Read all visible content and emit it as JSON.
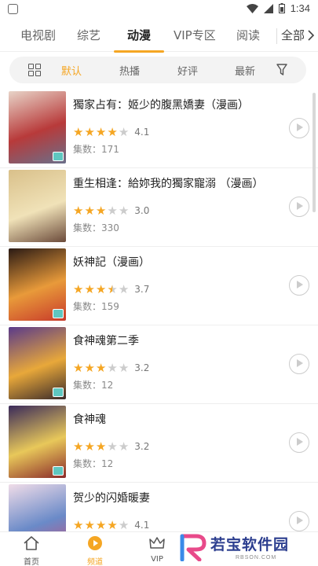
{
  "status_bar": {
    "time": "1:34"
  },
  "tabs": [
    {
      "label": "电视剧"
    },
    {
      "label": "综艺"
    },
    {
      "label": "动漫",
      "active": true
    },
    {
      "label": "VIP专区"
    },
    {
      "label": "阅读"
    }
  ],
  "tabs_more": "全部",
  "filters": [
    {
      "label": "默认",
      "active": true
    },
    {
      "label": "热播"
    },
    {
      "label": "好评"
    },
    {
      "label": "最新"
    }
  ],
  "items": [
    {
      "title": "獨家占有：姬少的腹黑嬌妻（漫画）",
      "rating": "4.1",
      "stars_filled": 4,
      "episodes": "集数：171",
      "cover_colors": [
        "#e8d4c8",
        "#b83a3a",
        "#6a6f8a"
      ]
    },
    {
      "title": "重生相逢：給妳我的獨家寵溺 （漫画）",
      "rating": "3.0",
      "stars_filled": 3,
      "episodes": "集数：330",
      "cover_colors": [
        "#d9c08a",
        "#f0e2b8",
        "#6b4a3a"
      ]
    },
    {
      "title": "妖神記（漫画）",
      "rating": "3.7",
      "stars_filled": 3.5,
      "episodes": "集数：159",
      "cover_colors": [
        "#2a1a14",
        "#e89a3a",
        "#c83a2a"
      ]
    },
    {
      "title": "食神魂第二季",
      "rating": "3.2",
      "stars_filled": 3,
      "episodes": "集数：12",
      "cover_colors": [
        "#5a3a8a",
        "#e8a83a",
        "#3a2a2a"
      ]
    },
    {
      "title": "食神魂",
      "rating": "3.2",
      "stars_filled": 3,
      "episodes": "集数：12",
      "cover_colors": [
        "#3a2a5a",
        "#e8c85a",
        "#8a2a2a"
      ]
    },
    {
      "title": "贺少的闪婚暖妻",
      "rating": "4.1",
      "stars_filled": 4,
      "episodes": "",
      "cover_colors": [
        "#f0dce8",
        "#6a8ac8",
        "#c84a7a"
      ]
    }
  ],
  "bottom_nav": [
    {
      "label": "首页",
      "icon": "home-icon"
    },
    {
      "label": "频道",
      "icon": "play-circle-icon",
      "active": true
    },
    {
      "label": "VIP",
      "icon": "crown-icon"
    }
  ],
  "watermark": {
    "text": "若宝软件园",
    "url": "RBSON.COM"
  },
  "colors": {
    "accent": "#f5a623",
    "star_off": "#cccccc",
    "watermark": "#2c3e8f"
  }
}
